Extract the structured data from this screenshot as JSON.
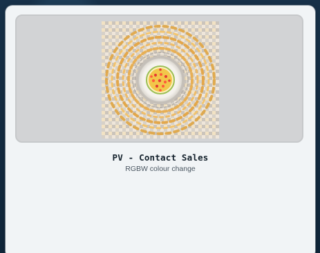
{
  "product": {
    "title": "PV - Contact Sales",
    "subtitle": "RGBW colour change",
    "image_subject": "led-downlight-reflector"
  },
  "colors": {
    "page_background": "#10263a",
    "card_background": "#f1f4f6",
    "media_background": "#d2d3d5",
    "title_color": "#14212c",
    "subtitle_color": "#4a5661"
  }
}
